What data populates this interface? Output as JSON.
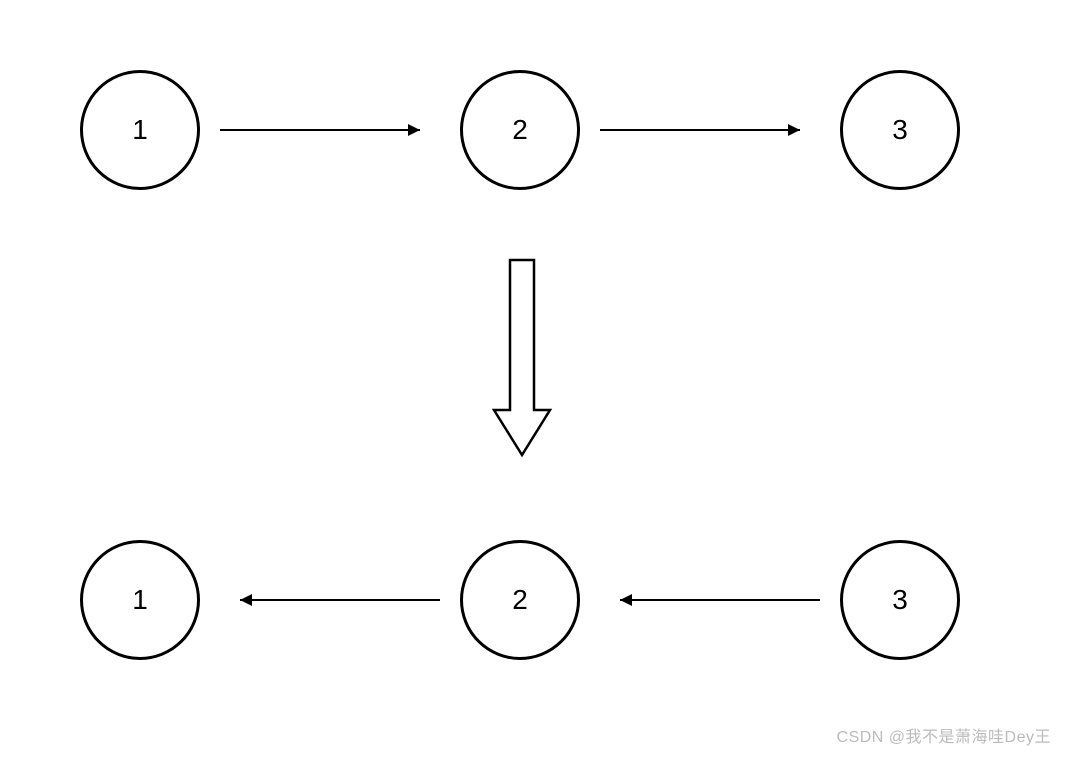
{
  "diagram": {
    "top_row": {
      "node1": "1",
      "node2": "2",
      "node3": "3"
    },
    "bottom_row": {
      "node1": "1",
      "node2": "2",
      "node3": "3"
    }
  },
  "watermark": "CSDN @我不是萧海哇Dey王"
}
